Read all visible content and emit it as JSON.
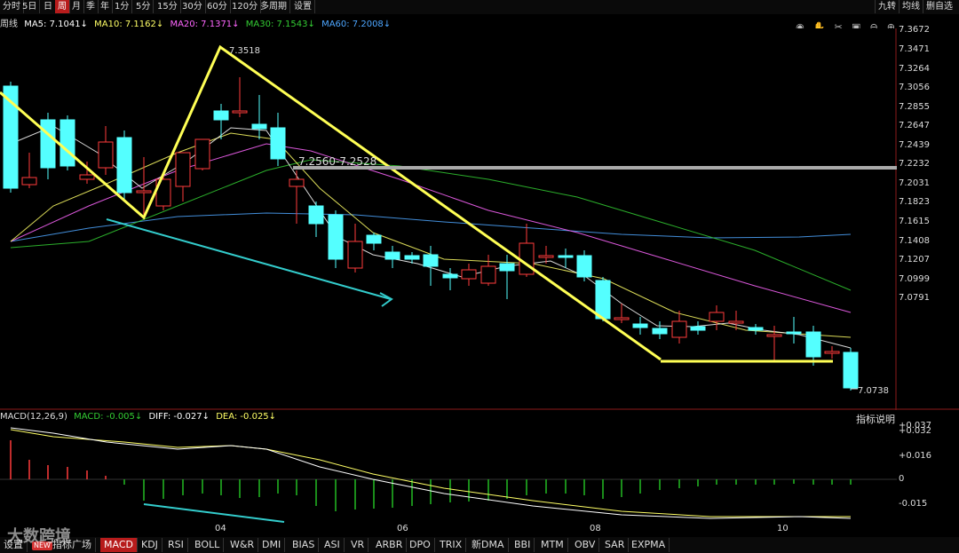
{
  "period_bar": {
    "items": [
      "分时",
      "5日",
      "日",
      "周",
      "月",
      "季",
      "年",
      "1分",
      "5分",
      "15分",
      "30分",
      "60分",
      "120分",
      "多周期",
      "设置"
    ],
    "active": "周"
  },
  "right_tools": [
    "九转",
    "均线",
    "删自选"
  ],
  "ma_legend": {
    "period_label": "周线",
    "ma5": "MA5: 7.1041↓",
    "ma10": "MA10: 7.1162↓",
    "ma20": "MA20: 7.1371↓",
    "ma30": "MA30: 7.1543↓",
    "ma60": "MA60: 7.2008↓"
  },
  "price_axis": [
    "7.3672",
    "7.3471",
    "7.3264",
    "7.3056",
    "7.2855",
    "7.2647",
    "7.2439",
    "7.2232",
    "7.2031",
    "7.1823",
    "7.1615",
    "7.1408",
    "7.1207",
    "7.0999",
    "7.0791"
  ],
  "annotations": {
    "high_label": "7.3518",
    "low_label": "7.0738",
    "resistance_label": "7.2560-7.2528"
  },
  "x_axis_labels": [
    "04",
    "06",
    "08",
    "10"
  ],
  "macd_legend": {
    "name": "MACD(12,26,9)",
    "macd": "MACD: -0.005↓",
    "diff": "DIFF: -0.027↓",
    "dea": "DEA: -0.025↓"
  },
  "indicator_help": "指标说明",
  "macd_axis": [
    "+0.037",
    "+0.032",
    "+0.016",
    "0",
    "-0.015"
  ],
  "bottom_tabs": {
    "settings": "设置",
    "new_badge": "NEW",
    "indicator": "指标广场",
    "items": [
      "MACD",
      "KDJ",
      "RSI",
      "BOLL",
      "W&R",
      "DMI",
      "BIAS",
      "ASI",
      "VR",
      "ARBR",
      "DPO",
      "TRIX",
      "新DMA",
      "BBI",
      "MTM",
      "OBV",
      "SAR",
      "EXPMA"
    ],
    "active": "MACD"
  },
  "watermark": "大数跨境",
  "colors": {
    "up": "#ff3b3b",
    "down": "#54ffff",
    "ma5": "#ffffff",
    "ma10": "#ffff66",
    "ma20": "#ff66ff",
    "ma30": "#33cc33",
    "ma60": "#4da6ff",
    "annotation_line": "#ffff55",
    "arrow": "#33cccc",
    "resistance": "#aaaaaa"
  }
}
